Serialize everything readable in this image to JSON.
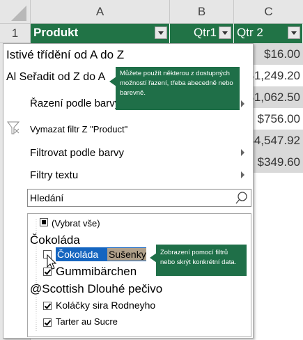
{
  "columns": [
    "A",
    "B",
    "C"
  ],
  "row_number": "1",
  "header": {
    "produkt": "Produkt",
    "qtr1": "Qtr1",
    "qtr2": "Qtr 2"
  },
  "values": [
    "$16.00",
    "$1,249.20",
    "$1,062.50",
    "$756.00",
    "$4,547.92",
    "$349.60"
  ],
  "menu": {
    "sort_az": "Istivé třídění od A do Z",
    "sort_za": "Al Seřadit od Z do A",
    "sort_color": "Řazení podle barvy",
    "clear_filter": "Vymazat filtr  Z \"Product\"",
    "filter_color": "Filtrovat podle barvy",
    "text_filters": "Filtry textu",
    "search_placeholder": "Hledání"
  },
  "tooltip_sort": "Můžete použít některou z dostupných možností řazení, třeba abecedně nebo barevně.",
  "tooltip_filter": "Zobrazení pomocí filtrů nebo skrýt konkrétní data.",
  "list": {
    "select_all": "(Vybrat vše)",
    "group1": "Čokoláda",
    "item_cokolada": "Čokoláda",
    "item_susenky": "Sušenky",
    "item_gummi": "Gummibärchen",
    "group2": "@Scottish Dlouhé pečivo",
    "item_kolacky": "Koláčky sira Rodneyho",
    "item_tarter": "Tarter au Sucre"
  },
  "colors": {
    "header_green": "#217346",
    "tooltip_green": "#1f6f48",
    "highlight_blue": "#1565c0",
    "highlight_tan": "#b0a08a"
  }
}
